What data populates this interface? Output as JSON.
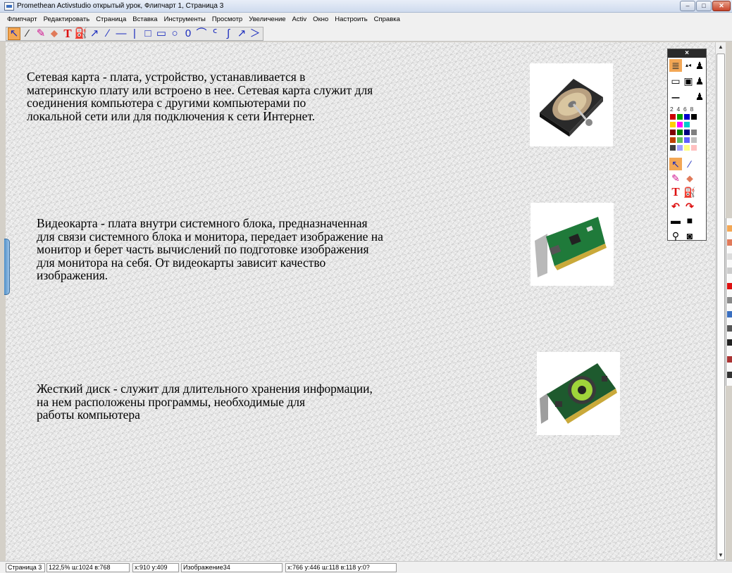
{
  "window": {
    "title": "Promethean Activstudio  открытый урок, Флипчарт 1, Страница 3",
    "buttons": {
      "minimize": "–",
      "maximize": "□",
      "close": "✕"
    }
  },
  "menu": [
    {
      "label": "Флипчарт"
    },
    {
      "label": "Редактировать"
    },
    {
      "label": "Страница"
    },
    {
      "label": "Вставка"
    },
    {
      "label": "Инструменты"
    },
    {
      "label": "Просмотр"
    },
    {
      "label": "Увеличение"
    },
    {
      "label": "Activ"
    },
    {
      "label": "Окно"
    },
    {
      "label": "Настроить"
    },
    {
      "label": "Справка"
    }
  ],
  "toolbar": [
    {
      "name": "select-tool-icon",
      "glyph": "↖",
      "cls": "sel"
    },
    {
      "name": "pen-tool-icon",
      "glyph": "⁄",
      "cls": "pen"
    },
    {
      "name": "highlighter-tool-icon",
      "glyph": "✎",
      "cls": "mag"
    },
    {
      "name": "eraser-tool-icon",
      "glyph": "⬥",
      "cls": "era"
    },
    {
      "name": "text-tool-icon",
      "glyph": "T",
      "cls": "txt"
    },
    {
      "name": "fill-tool-icon",
      "glyph": "⛽",
      "cls": ""
    },
    {
      "name": "arrow-line-tool-icon",
      "glyph": "↗",
      "cls": ""
    },
    {
      "name": "diagonal-line-tool-icon",
      "glyph": "∕",
      "cls": ""
    },
    {
      "name": "horizontal-line-tool-icon",
      "glyph": "—",
      "cls": ""
    },
    {
      "name": "vertical-line-tool-icon",
      "glyph": "|",
      "cls": ""
    },
    {
      "name": "square-tool-icon",
      "glyph": "□",
      "cls": ""
    },
    {
      "name": "rectangle-tool-icon",
      "glyph": "▭",
      "cls": ""
    },
    {
      "name": "ellipse-tool-icon",
      "glyph": "○",
      "cls": ""
    },
    {
      "name": "circle-tool-icon",
      "glyph": "0",
      "cls": ""
    },
    {
      "name": "arc-tool-icon",
      "glyph": "⌒",
      "cls": ""
    },
    {
      "name": "curve-tool-icon",
      "glyph": "ᑦ",
      "cls": ""
    },
    {
      "name": "curve2-tool-icon",
      "glyph": "∫",
      "cls": ""
    },
    {
      "name": "arrow-tool-icon",
      "glyph": "↗",
      "cls": ""
    },
    {
      "name": "chevron-tool-icon",
      "glyph": "＞",
      "cls": ""
    }
  ],
  "content": {
    "paragraph1": [
      "Сетевая карта - плата, устройство, устанавливается в",
      "материнскую плату или встроено в нее. Сетевая карта служит для",
      "соединения компьютера с другими компьютерами по",
      "локальной сети или для подключения к сети Интернет."
    ],
    "paragraph2": [
      "Видеокарта - плата внутри системного блока, предназначенная",
      "для связи системного блока и монитора, передает изображение на",
      "монитор и берет часть вычислений по подготовке изображения",
      "для монитора на себя. От видеокарты зависит качество",
      "изображения."
    ],
    "paragraph3": [
      "Жесткий диск - служит для длительного хранения информации,",
      "на нем расположены программы, необходимые для",
      "работы компьютера"
    ]
  },
  "toolbox": {
    "close_label": "×",
    "widths_label": "2 4 6 8",
    "colors": [
      "#cc0000",
      "#00a000",
      "#0000cc",
      "#000000",
      "#ffd000",
      "#ff00ff",
      "#00cccc",
      "#ffffff",
      "#800000",
      "#008000",
      "#000080",
      "#808080",
      "#c04000",
      "#60c060",
      "#6060ff",
      "#c0c0c0",
      "#404040",
      "#a0a0ff",
      "#ffff80",
      "#ffc0c0"
    ]
  },
  "status": {
    "page": "Страница 3",
    "zoom": "122,5% ш:1024 в:768",
    "cursor": "x:910 y:409",
    "object": "Изображение34",
    "bounds": "x:766 y:446 ш:118 в:118 у:0?"
  }
}
